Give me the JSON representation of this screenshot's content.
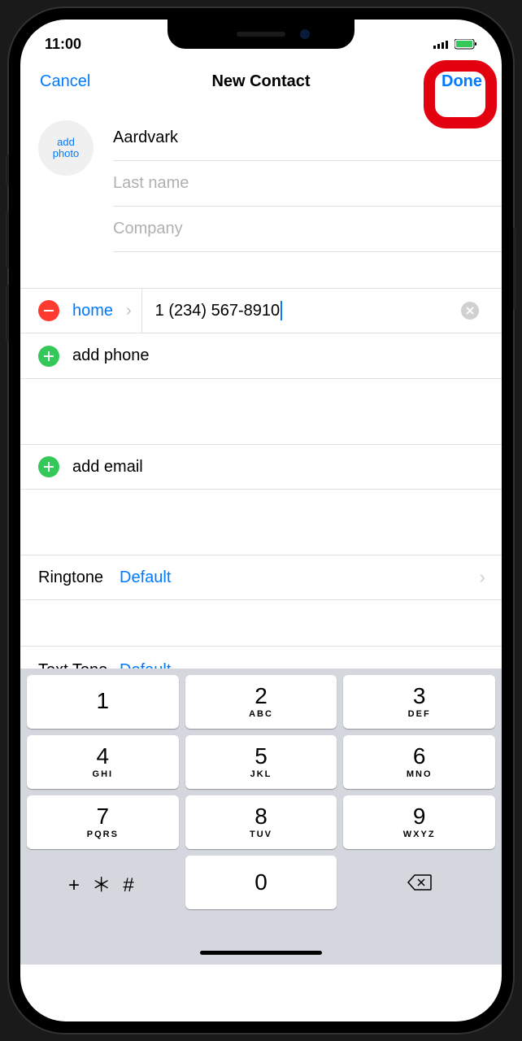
{
  "status": {
    "time": "11:00"
  },
  "nav": {
    "cancel": "Cancel",
    "title": "New Contact",
    "done": "Done"
  },
  "photo": {
    "line1": "add",
    "line2": "photo"
  },
  "fields": {
    "firstName": "Aardvark",
    "lastNamePlaceholder": "Last name",
    "companyPlaceholder": "Company"
  },
  "phone": {
    "label": "home",
    "value": "1 (234) 567-8910"
  },
  "addPhone": "add phone",
  "addEmail": "add email",
  "ringtone": {
    "label": "Ringtone",
    "value": "Default"
  },
  "textTone": {
    "label": "Text Tone",
    "value": "Default"
  },
  "keypad": {
    "k1": {
      "num": "1",
      "letters": ""
    },
    "k2": {
      "num": "2",
      "letters": "ABC"
    },
    "k3": {
      "num": "3",
      "letters": "DEF"
    },
    "k4": {
      "num": "4",
      "letters": "GHI"
    },
    "k5": {
      "num": "5",
      "letters": "JKL"
    },
    "k6": {
      "num": "6",
      "letters": "MNO"
    },
    "k7": {
      "num": "7",
      "letters": "PQRS"
    },
    "k8": {
      "num": "8",
      "letters": "TUV"
    },
    "k9": {
      "num": "9",
      "letters": "WXYZ"
    },
    "k0": {
      "num": "0"
    },
    "symbols": "+ ＊ #"
  }
}
